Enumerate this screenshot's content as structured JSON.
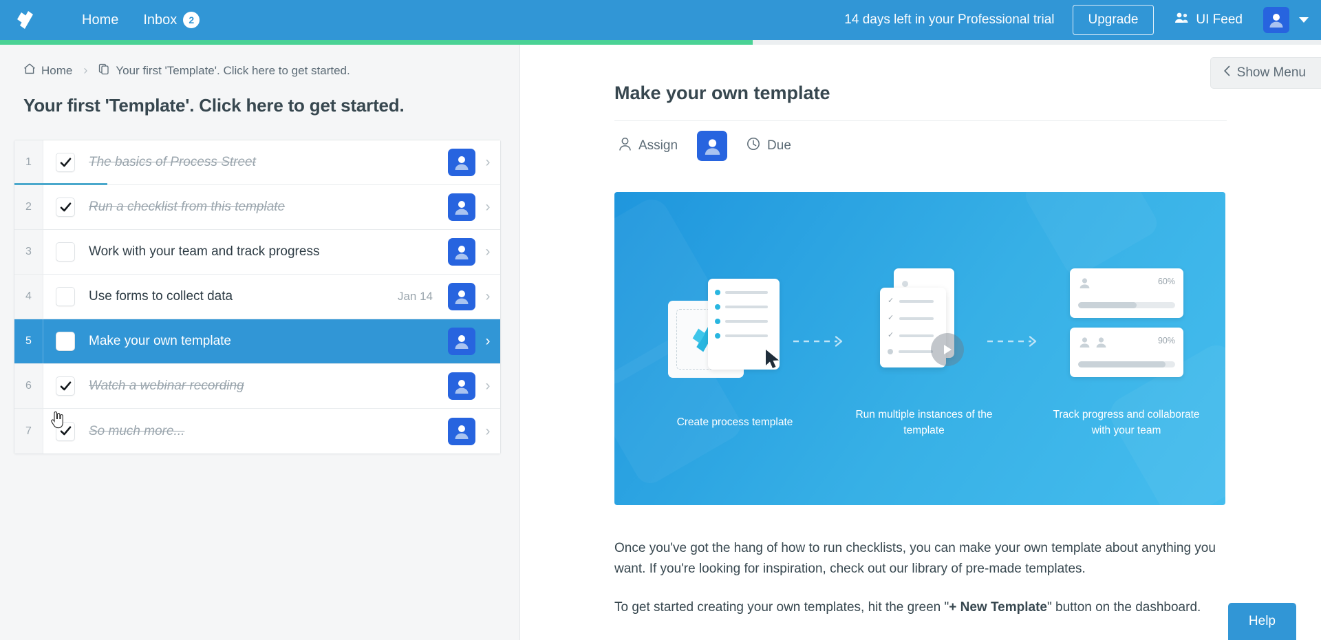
{
  "topbar": {
    "logo_icon": "process-street-logo-icon",
    "home_label": "Home",
    "inbox_label": "Inbox",
    "inbox_count": "2",
    "trial_text": "14 days left in your Professional trial",
    "upgrade_label": "Upgrade",
    "uifeed_label": "UI Feed",
    "uifeed_icon": "people-group-icon",
    "avatar_icon": "user-avatar-icon",
    "caret_icon": "chevron-down-icon",
    "background_color": "#3196d6"
  },
  "progress": {
    "percent": 57,
    "fill_color": "#4ad295",
    "track_color": "#eceff1"
  },
  "left_pane": {
    "breadcrumb": {
      "home_icon": "home-icon",
      "home_label": "Home",
      "separator": "›",
      "doc_icon": "copy-document-icon",
      "current_label": "Your first 'Template'. Click here to get started."
    },
    "page_title": "Your first 'Template'. Click here to get started.",
    "tasks": [
      {
        "number": "1",
        "label": "The basics of Process Street",
        "checked": true,
        "selected": false,
        "due": "",
        "avatar_icon": "user-avatar-icon",
        "chevron_icon": "chevron-right-icon",
        "underline": true
      },
      {
        "number": "2",
        "label": "Run a checklist from this template",
        "checked": true,
        "selected": false,
        "due": "",
        "avatar_icon": "user-avatar-icon",
        "chevron_icon": "chevron-right-icon",
        "underline": false
      },
      {
        "number": "3",
        "label": "Work with your team and track progress",
        "checked": false,
        "selected": false,
        "due": "",
        "avatar_icon": "user-avatar-icon",
        "chevron_icon": "chevron-right-icon",
        "underline": false
      },
      {
        "number": "4",
        "label": "Use forms to collect data",
        "checked": false,
        "selected": false,
        "due": "Jan 14",
        "avatar_icon": "user-avatar-icon",
        "chevron_icon": "chevron-right-icon",
        "underline": false
      },
      {
        "number": "5",
        "label": "Make your own template",
        "checked": false,
        "selected": true,
        "due": "",
        "avatar_icon": "user-avatar-icon",
        "chevron_icon": "chevron-right-icon",
        "underline": false
      },
      {
        "number": "6",
        "label": "Watch a webinar recording",
        "checked": true,
        "selected": false,
        "due": "",
        "avatar_icon": "user-avatar-icon",
        "chevron_icon": "chevron-right-icon",
        "underline": false
      },
      {
        "number": "7",
        "label": "So much more...",
        "checked": true,
        "selected": false,
        "due": "",
        "avatar_icon": "user-avatar-icon",
        "chevron_icon": "chevron-right-icon",
        "underline": false
      }
    ]
  },
  "right_pane": {
    "show_menu_label": "Show Menu",
    "show_menu_icon": "chevron-left-icon",
    "task_heading": "Make your own template",
    "assign_label": "Assign",
    "assign_icon": "user-icon",
    "due_label": "Due",
    "due_icon": "clock-icon",
    "assignee_avatar_icon": "user-avatar-icon",
    "illustration": {
      "steps": [
        {
          "caption": "Create process template",
          "icon": "document-checklist-icon"
        },
        {
          "caption": "Run multiple instances of the template",
          "icon": "document-play-icon"
        },
        {
          "caption": "Track progress and collaborate with your team",
          "icon": "progress-cards-icon"
        }
      ],
      "progress_cards": [
        {
          "percent": "60%",
          "fill": 60,
          "members": 1
        },
        {
          "percent": "90%",
          "fill": 90,
          "members": 2
        }
      ],
      "arrow_icon": "dashed-arrow-right-icon",
      "background_color": "#2ea7e3"
    },
    "paragraphs": [
      {
        "runs": [
          {
            "text": "Once you've got the hang of how to run checklists, you can make your own template about anything you want. If you're looking for inspiration, check out our library of pre-made templates.",
            "bold": false
          }
        ]
      },
      {
        "runs": [
          {
            "text": "To get started creating your own templates, hit the green \"",
            "bold": false
          },
          {
            "text": "+ New Template",
            "bold": true
          },
          {
            "text": "\" button on the dashboard.",
            "bold": false
          }
        ]
      }
    ],
    "help_label": "Help"
  }
}
